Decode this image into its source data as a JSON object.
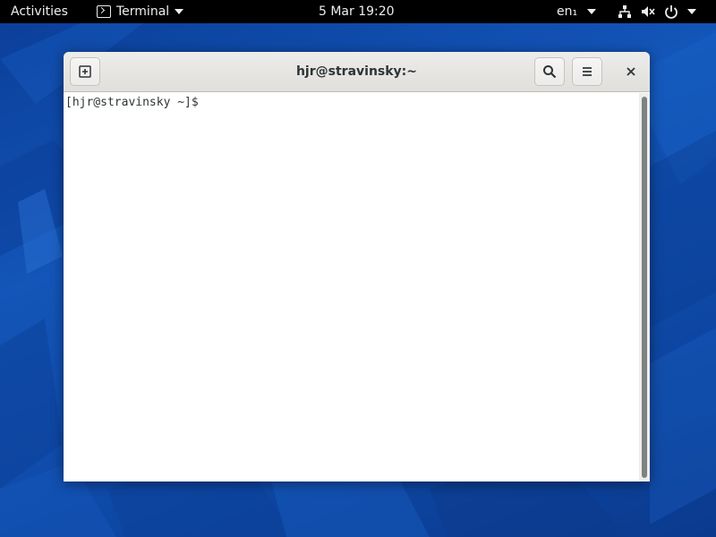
{
  "topbar": {
    "activities": "Activities",
    "app_name": "Terminal",
    "clock": "5 Mar  19:20",
    "language": "en₁",
    "icons": [
      "terminal-icon",
      "network-icon",
      "volume-muted-icon",
      "power-icon",
      "chevron-down-icon"
    ]
  },
  "window": {
    "title": "hjr@stravinsky:~",
    "buttons": [
      "new-tab-icon",
      "search-icon",
      "menu-icon",
      "close-icon"
    ]
  },
  "terminal": {
    "prompt": "[hjr@stravinsky ~]$"
  },
  "colors": {
    "topbar_bg": "#000000",
    "wallpaper": "#1355b8",
    "headerbar": "#e1dfdc",
    "terminal_bg": "#ffffff",
    "scrollbar_thumb": "#7e8283"
  }
}
